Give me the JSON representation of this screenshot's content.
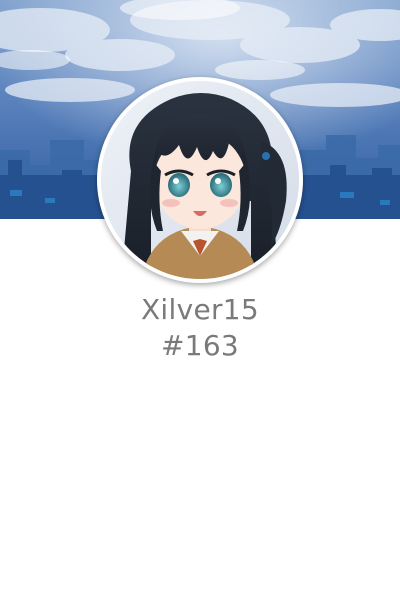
{
  "profile": {
    "username": "Xilver15",
    "rank": "#163"
  },
  "banner": {
    "scene": "blue-sky-city-background"
  },
  "avatar": {
    "subject": "anime-girl-portrait"
  },
  "colors": {
    "text": "#7a7a7a",
    "banner_sky": "#3f6aa8",
    "ring": "#ffffff"
  }
}
